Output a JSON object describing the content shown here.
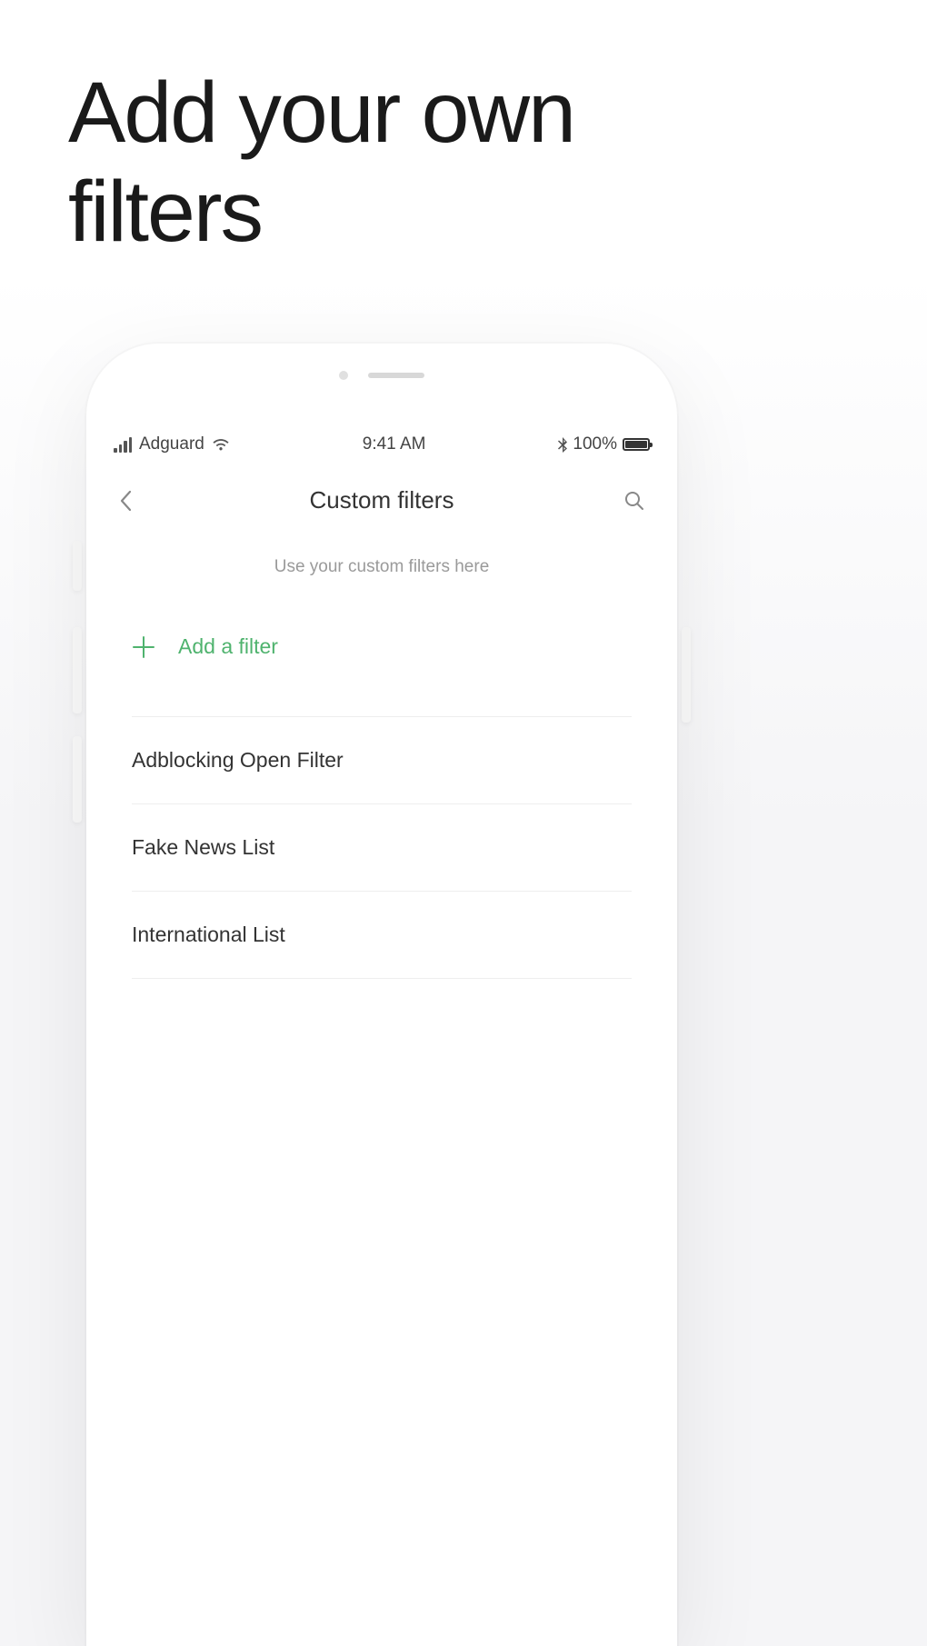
{
  "hero": {
    "title_line1": "Add your own",
    "title_line2": "filters"
  },
  "status_bar": {
    "carrier": "Adguard",
    "time": "9:41 AM",
    "battery_pct": "100%"
  },
  "nav": {
    "title": "Custom filters"
  },
  "subtitle": "Use your custom filters here",
  "add_button": {
    "label": "Add a filter"
  },
  "filters": [
    {
      "name": "Adblocking Open Filter"
    },
    {
      "name": "Fake News List"
    },
    {
      "name": "International List"
    }
  ],
  "colors": {
    "accent": "#4fb36e"
  }
}
